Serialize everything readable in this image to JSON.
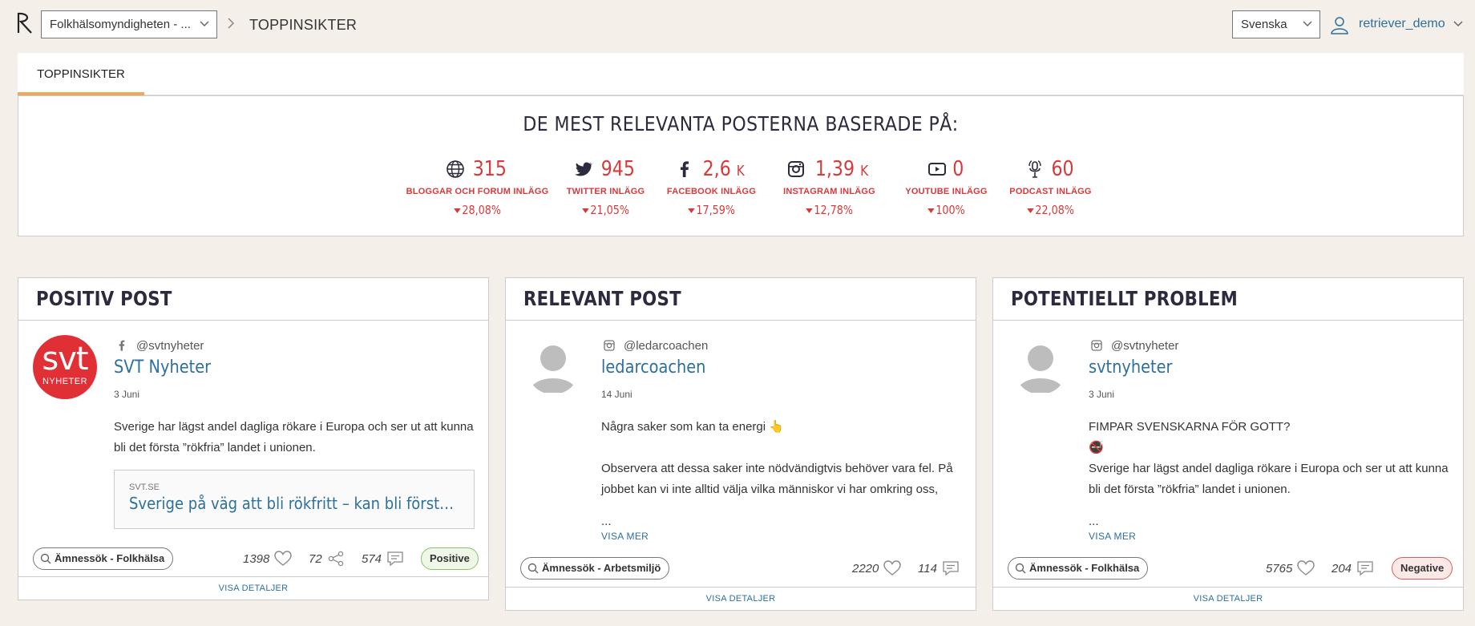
{
  "header": {
    "org_select_value": "Folkhälsomyndigheten - ...",
    "page_title": "TOPPINSIKTER",
    "language_value": "Svenska",
    "user_name": "retriever_demo"
  },
  "tabs": [
    {
      "label": "TOPPINSIKTER",
      "active": true
    }
  ],
  "insights": {
    "title": "DE MEST RELEVANTA POSTERNA BASERADE PÅ:",
    "stats": [
      {
        "icon": "globe-icon",
        "value": "315",
        "unit": "",
        "label": "BLOGGAR OCH FORUM INLÄGG",
        "change": "28,08%"
      },
      {
        "icon": "twitter-icon",
        "value": "945",
        "unit": "",
        "label": "TWITTER INLÄGG",
        "change": "21,05%"
      },
      {
        "icon": "facebook-icon",
        "value": "2,6",
        "unit": "K",
        "label": "FACEBOOK INLÄGG",
        "change": "17,59%"
      },
      {
        "icon": "instagram-icon",
        "value": "1,39",
        "unit": "K",
        "label": "INSTAGRAM INLÄGG",
        "change": "12,78%"
      },
      {
        "icon": "youtube-icon",
        "value": "0",
        "unit": "",
        "label": "YOUTUBE INLÄGG",
        "change": "100%"
      },
      {
        "icon": "podcast-icon",
        "value": "60",
        "unit": "",
        "label": "PODCAST INLÄGG",
        "change": "22,08%"
      }
    ]
  },
  "cards": [
    {
      "title": "POSITIV POST",
      "source_icon": "facebook-icon",
      "avatar_logo_text": "svt",
      "avatar_logo_sub": "NYHETER",
      "handle": "@svtnyheter",
      "author": "SVT Nyheter",
      "date": "3 Juni",
      "text": "Sverige har lägst andel dagliga rökare i Europa och ser ut att kunna bli det första ”rökfria” landet i unionen.",
      "link_domain": "SVT.SE",
      "link_title": "Sverige på väg att bli rökfritt – kan bli första l...",
      "tag": "Ämnessök - Folkhälsa",
      "likes": "1398",
      "shares": "72",
      "comments": "574",
      "sentiment": "Positive",
      "details": "VISA DETALJER"
    },
    {
      "title": "RELEVANT POST",
      "source_icon": "instagram-icon",
      "handle": "@ledarcoachen",
      "author": "ledarcoachen",
      "date": "14 Juni",
      "text_line1": "Några saker som kan ta energi 👆",
      "text_line2": "Observera att dessa saker inte nödvändigtvis behöver vara fel. På jobbet kan vi inte alltid välja vilka människor vi har omkring oss,",
      "ellipsis": "...",
      "more": "VISA MER",
      "tag": "Ämnessök - Arbetsmiljö",
      "likes": "2220",
      "comments": "114",
      "details": "VISA DETALJER"
    },
    {
      "title": "POTENTIELLT PROBLEM",
      "source_icon": "instagram-icon",
      "handle": "@svtnyheter",
      "author": "svtnyheter",
      "date": "3 Juni",
      "text_line1": "FIMPAR SVENSKARNA FÖR GOTT?",
      "emoji": "🚭",
      "text_line2": "Sverige har lägst andel dagliga rökare i Europa och ser ut att kunna bli det första ”rökfria” landet i unionen.",
      "ellipsis": "...",
      "more": "VISA MER",
      "tag": "Ämnessök - Folkhälsa",
      "likes": "5765",
      "comments": "204",
      "sentiment": "Negative",
      "details": "VISA DETALJER"
    }
  ],
  "colors": {
    "background": "#f5efe9",
    "accent_red": "#d63b3b",
    "link_blue": "#2d6f9d",
    "tab_underline": "#f2a65a"
  }
}
